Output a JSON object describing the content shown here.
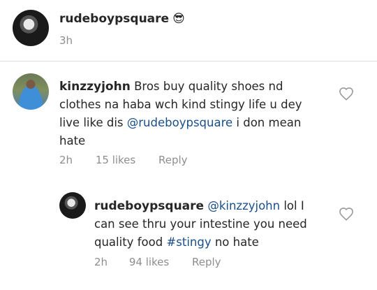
{
  "post": {
    "author": "rudeboypsquare",
    "author_emoji": "😎",
    "time": "3h"
  },
  "comments": [
    {
      "author": "kinzzyjohn",
      "text_parts": [
        "Bros buy quality shoes nd clothes na haba wch kind stingy life u dey live like dis ",
        "@rudeboypsquare",
        " i don mean hate"
      ],
      "time": "2h",
      "likes": "15 likes",
      "reply": "Reply"
    },
    {
      "author": "rudeboypsquare",
      "text_parts": [
        "@kinzzyjohn",
        " lol I can see thru your intestine you need quality food ",
        "#stingy",
        " no hate"
      ],
      "time": "2h",
      "likes": "94 likes",
      "reply": "Reply"
    }
  ],
  "icons": {
    "like": "heart-outline-icon"
  }
}
